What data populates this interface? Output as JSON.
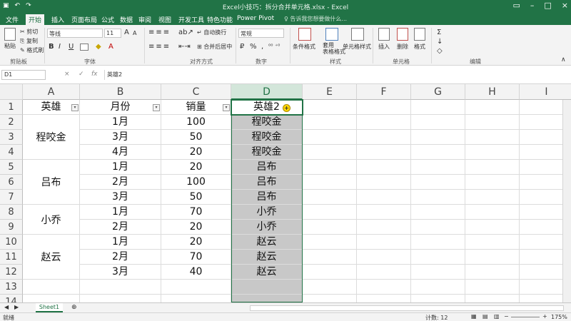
{
  "titlebar": {
    "title": "Excel小技巧：拆分合并单元格.xlsx - Excel",
    "qa_icons": [
      "save-icon",
      "undo-icon",
      "redo-icon"
    ],
    "window_controls": [
      "ribbon-display-icon",
      "minimize-icon",
      "maximize-icon",
      "close-icon"
    ]
  },
  "tabs": [
    "文件",
    "开始",
    "插入",
    "页面布局",
    "公式",
    "数据",
    "审阅",
    "视图",
    "开发工具",
    "特色功能",
    "Power Pivot"
  ],
  "active_tab": "开始",
  "tell_me": "告诉我您想要做什么...",
  "ribbon": {
    "clipboard": {
      "paste": "粘贴",
      "cut": "剪切",
      "copy": "复制",
      "painter": "格式刷",
      "group": "剪贴板"
    },
    "font": {
      "name": "等线",
      "size": "11",
      "grow": "A",
      "shrink": "A",
      "bold": "B",
      "italic": "I",
      "underline": "U",
      "group": "字体"
    },
    "alignment": {
      "wrap": "自动换行",
      "merge": "合并后居中",
      "group": "对齐方式"
    },
    "number": {
      "format": "常规",
      "percent": "%",
      "group": "数字"
    },
    "styles": {
      "conditional": "条件格式",
      "table": "套用\n表格格式",
      "cell": "单元格样式",
      "group": "样式"
    },
    "cells": {
      "insert": "插入",
      "delete": "删除",
      "format": "格式",
      "group": "单元格"
    },
    "editing": {
      "group": "编辑"
    }
  },
  "formula_bar": {
    "name_box": "D1",
    "cancel": "×",
    "enter": "✓",
    "fx": "fx",
    "content": "英雄2"
  },
  "columns": [
    "A",
    "B",
    "C",
    "D",
    "E",
    "F",
    "G",
    "H",
    "I"
  ],
  "rows": [
    "1",
    "2",
    "3",
    "4",
    "5",
    "6",
    "7",
    "8",
    "9",
    "10",
    "11",
    "12",
    "13",
    "14"
  ],
  "table": {
    "headers": [
      "英雄",
      "月份",
      "销量",
      "英雄2"
    ],
    "merged_heroes": [
      {
        "name": "程咬金"
      },
      {
        "name": "吕布"
      },
      {
        "name": "小乔"
      },
      {
        "name": "赵云"
      }
    ],
    "months": [
      "1月",
      "3月",
      "4月",
      "1月",
      "2月",
      "3月",
      "1月",
      "2月",
      "1月",
      "2月",
      "3月"
    ],
    "sales": [
      "100",
      "50",
      "20",
      "20",
      "100",
      "50",
      "70",
      "20",
      "20",
      "70",
      "40"
    ],
    "hero2": [
      "程咬金",
      "程咬金",
      "程咬金",
      "吕布",
      "吕布",
      "吕布",
      "小乔",
      "小乔",
      "赵云",
      "赵云",
      "赵云"
    ]
  },
  "colors": {
    "accent": "#217346",
    "selection": "#c8c8c8"
  },
  "sheets": [
    "Sheet1"
  ],
  "add_sheet": "⊕",
  "status": {
    "mode": "就绪",
    "count_label": "计数: 12",
    "zoom": "175%",
    "zoom_minus": "−",
    "zoom_plus": "+"
  }
}
